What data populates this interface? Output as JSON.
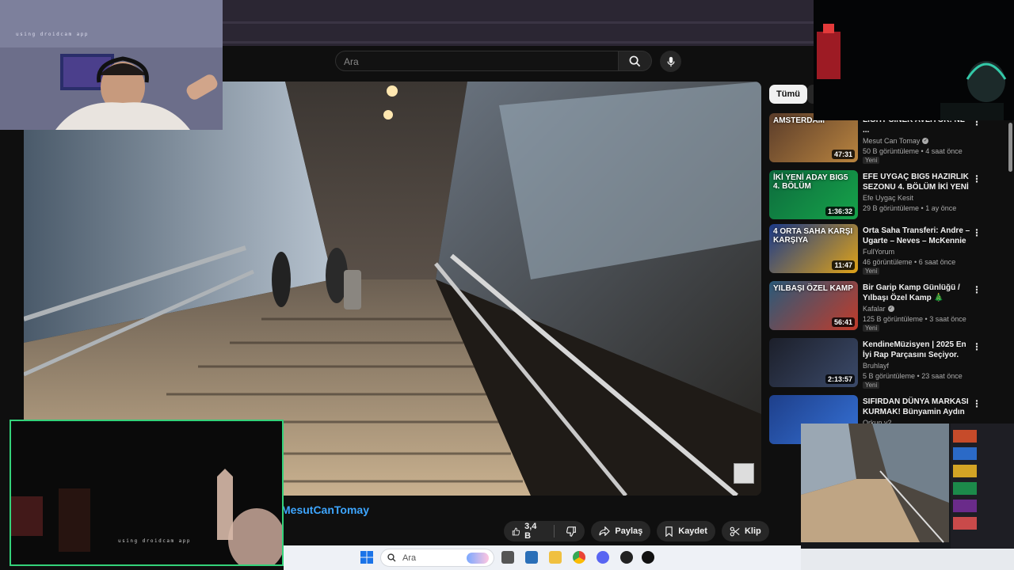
{
  "search": {
    "placeholder": "Ara"
  },
  "video": {
    "channel": "MesutCanTomay",
    "likes": "3,4 B",
    "share_label": "Paylaş",
    "save_label": "Kaydet",
    "clip_label": "Klip",
    "more_label": "•••"
  },
  "overlays": {
    "cam_caption": "using droidcam app"
  },
  "sidebar": {
    "chip_all": "Tümü",
    "items": [
      {
        "title": "LIGHT SİNEK AVLIYOR! NL ...",
        "channel": "Mesut Can Tomay",
        "verified": true,
        "meta": "50 B görüntüleme • 4 saat önce",
        "badge": "Yeni",
        "duration": "47:31",
        "thumb_text": "AMSTERDAM",
        "thumb_colors": [
          "#5a3c2a",
          "#b9843f"
        ]
      },
      {
        "title": "EFE UYGAÇ BIG5 HAZIRLIK SEZONU 4. BÖLÜM İKİ YENİ ...",
        "channel": "Efe Uygaç Kesit",
        "verified": false,
        "meta": "29 B görüntüleme • 1 ay önce",
        "badge": "",
        "duration": "1:36:32",
        "thumb_text": "İKİ YENİ ADAY BIG5 4. BÖLÜM",
        "thumb_colors": [
          "#0d6b3d",
          "#16a34a"
        ]
      },
      {
        "title": "Orta Saha Transferi: Andre – Ugarte – Neves – McKennie | ...",
        "channel": "FullYorum",
        "verified": false,
        "meta": "46 görüntüleme • 6 saat önce",
        "badge": "Yeni",
        "duration": "11:47",
        "thumb_text": "4 ORTA SAHA KARŞI KARŞIYA",
        "thumb_colors": [
          "#1b3a8a",
          "#e0a317"
        ]
      },
      {
        "title": "Bir Garip Kamp Günlüğü / Yılbaşı Özel Kamp 🎄",
        "channel": "Kafalar",
        "verified": true,
        "meta": "125 B görüntüleme • 3 saat önce",
        "badge": "Yeni",
        "duration": "56:41",
        "thumb_text": "YILBAŞI ÖZEL KAMP",
        "thumb_colors": [
          "#2a5a7a",
          "#c23b2a"
        ]
      },
      {
        "title": "KendineMüzisyen | 2025 En İyi Rap Parçasını Seçiyor. Quizi",
        "channel": "Bruhlayf",
        "verified": false,
        "meta": "5 B görüntüleme • 23 saat önce",
        "badge": "Yeni",
        "duration": "2:13:57",
        "thumb_text": "",
        "thumb_colors": [
          "#1c1f2a",
          "#3b4a6a"
        ]
      },
      {
        "title": "SIFIRDAN DÜNYA MARKASI KURMAK! Bünyamin Aydın ile ...",
        "channel": "Orkun v2",
        "verified": false,
        "meta": "",
        "badge": "",
        "duration": "",
        "thumb_text": "",
        "thumb_colors": [
          "#1e3f8a",
          "#3571d6"
        ]
      }
    ]
  },
  "taskbar": {
    "search_label": "Ara"
  }
}
